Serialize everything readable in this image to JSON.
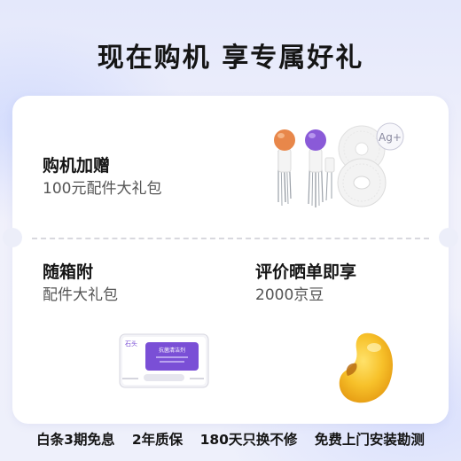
{
  "headline": "现在购机 享专属好礼",
  "gift1": {
    "title": "购机加赠",
    "subtitle": "100元配件大礼包"
  },
  "gift2": {
    "title": "随箱附",
    "subtitle": "配件大礼包"
  },
  "gift3": {
    "title": "评价晒单即享",
    "subtitle": "2000京豆"
  },
  "pad_badge": "Ag+",
  "box_brand": "石头",
  "box_label": "抗菌清洁剂",
  "footer": [
    "白条3期免息",
    "2年质保",
    "180天只换不修",
    "免费上门安装勘测"
  ],
  "colors": {
    "brush_orange": "#e8874a",
    "brush_purple": "#8a5ad8",
    "box_purple": "#7a4fd6",
    "bean_yellow": "#f7c12a"
  }
}
